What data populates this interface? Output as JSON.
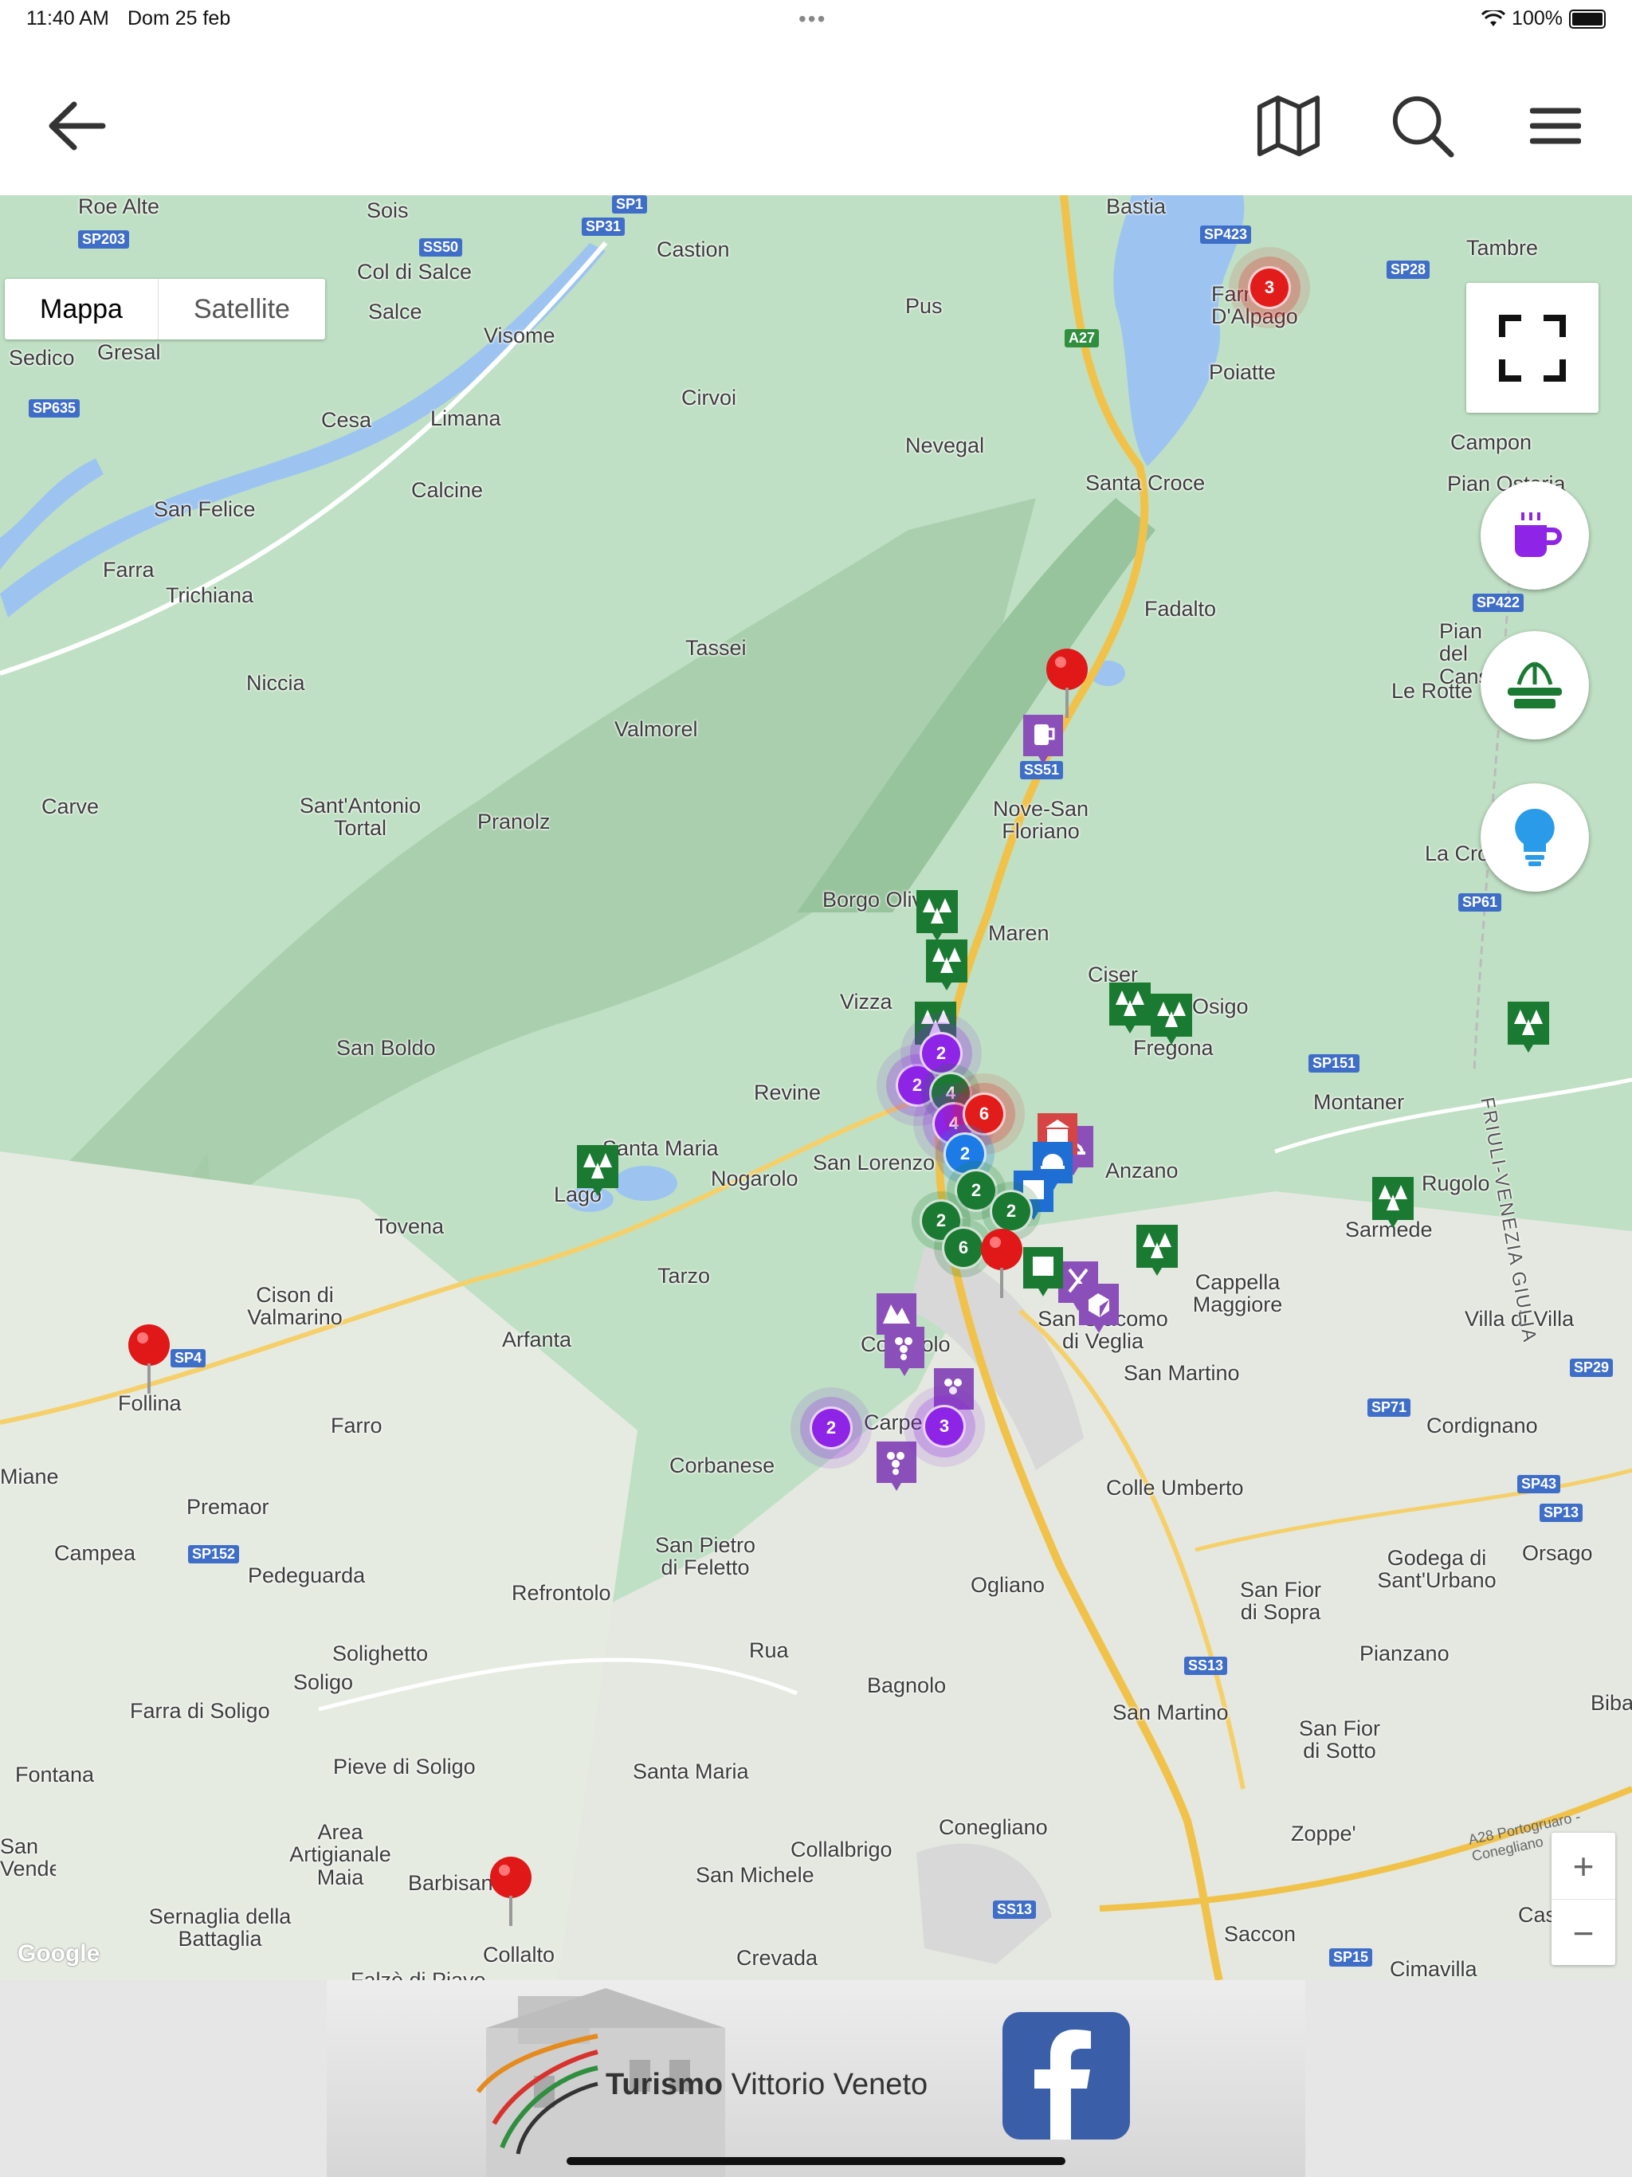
{
  "status": {
    "time": "11:40 AM",
    "date": "Dom 25 feb",
    "battery": "100%"
  },
  "header": {
    "back_icon": "arrow-left-icon",
    "map_icon": "map-icon",
    "search_icon": "search-icon",
    "menu_icon": "hamburger-menu-icon"
  },
  "map": {
    "type_control": {
      "map_label": "Mappa",
      "satellite_label": "Satellite",
      "selected": "Mappa"
    },
    "attribution": "Google",
    "zoom_in": "+",
    "zoom_out": "−",
    "places": [
      "Roe Alte",
      "Sois",
      "Bastia",
      "Tambre",
      "Castion",
      "Col di Salce",
      "Salce",
      "Visome",
      "Sedico",
      "Gresal",
      "Pus",
      "Farra D'Alpago",
      "Poiatte",
      "Cirvoi",
      "Cesa",
      "Limana",
      "Nevegal",
      "Campon",
      "Calcine",
      "San Felice",
      "Santa Croce",
      "Pian Osteria",
      "Farra",
      "Trichiana",
      "Fadalto",
      "Tassei",
      "Pian del Cansiglio",
      "Niccia",
      "Le Rotte",
      "Valmorel",
      "Carve",
      "Sant'Antonio Tortal",
      "Pranolz",
      "Nove-San Floriano",
      "La Crosetta",
      "Borgo Olivi",
      "Maren",
      "Ciser",
      "Osigo",
      "Vizza",
      "San Boldo",
      "Fregona",
      "Revine",
      "Montaner",
      "Santa Maria",
      "Nogarolo",
      "San Lorenzo",
      "Anzano",
      "Rugolo",
      "Lago",
      "Sarmede",
      "Tovena",
      "Tarzo",
      "Cappella Maggiore",
      "Cison di Valmarino",
      "Arfanta",
      "Cozzuolo",
      "San Giacomo di Veglia",
      "Villa di Villa",
      "Follina",
      "San Martino",
      "Farro",
      "Carpesica",
      "Cordignano",
      "Miane",
      "Corbanese",
      "Premaor",
      "Colle Umberto",
      "Campea",
      "Pedeguarda",
      "San Pietro di Feletto",
      "Refrontolo",
      "Ogliano",
      "Godega di Sant'Urbano",
      "Orsago",
      "San Fior di Sopra",
      "Solighetto",
      "Soligo",
      "Rua",
      "Bagnolo",
      "Pianzano",
      "Farra di Soligo",
      "San Martino",
      "Bibano",
      "Fontana",
      "Pieve di Soligo",
      "Santa Maria",
      "San Fior di Sotto",
      "San Vendemiano",
      "Area Artigianale Maia",
      "Conegliano",
      "Zoppe'",
      "Collalbrigo",
      "Barbisano",
      "San Michele",
      "Sernaglia della Battaglia",
      "Case D",
      "Saccon",
      "Collalto",
      "Crevada",
      "Cimavilla",
      "Falzè di Piave",
      "FRIULI-VENEZIA GIULIA"
    ],
    "roads": [
      "SP1",
      "SP203",
      "SS50",
      "SP31",
      "SP423",
      "SP28",
      "A27",
      "SP635",
      "SP422",
      "SS51",
      "SP61",
      "SP151",
      "SP4",
      "SP152",
      "SP29",
      "SP71",
      "SP43",
      "SP13",
      "SS13",
      "SP15",
      "A28 Portogruaro - Conegliano",
      "SS13"
    ],
    "clusters": [
      "3",
      "2",
      "2",
      "4",
      "4",
      "6",
      "2",
      "2",
      "2",
      "2",
      "6",
      "2",
      "3"
    ],
    "poi_icons": [
      "forest-icon",
      "beer-icon",
      "winery-icon",
      "restaurant-icon",
      "museum-icon",
      "shopping-icon",
      "attraction-icon",
      "location-pin-icon"
    ],
    "filters": [
      {
        "name": "coffee-filter",
        "icon": "coffee-cup-icon",
        "color": "#8e24e6"
      },
      {
        "name": "fountain-filter",
        "icon": "fountain-icon",
        "color": "#1b7a32"
      },
      {
        "name": "lightbulb-filter",
        "icon": "lightbulb-icon",
        "color": "#2a9be8"
      }
    ]
  },
  "footer": {
    "brand_bold": "Turismo",
    "brand_rest": " Vittorio Veneto",
    "facebook_icon": "facebook-icon"
  }
}
